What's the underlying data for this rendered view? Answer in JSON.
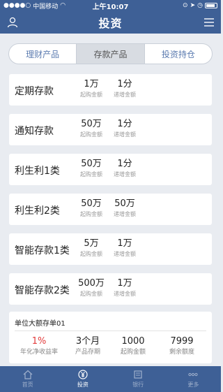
{
  "status": {
    "carrier": "中国移动",
    "time": "上午10:07"
  },
  "nav": {
    "title": "投资"
  },
  "segments": [
    "理财产品",
    "存款产品",
    "投资持仓"
  ],
  "products": [
    {
      "name": "定期存款",
      "min_amount": "1万",
      "min_label": "起购金额",
      "step": "1分",
      "step_label": "递增金额"
    },
    {
      "name": "通知存款",
      "min_amount": "50万",
      "min_label": "起购金额",
      "step": "1分",
      "step_label": "递增金额"
    },
    {
      "name": "利生利1类",
      "min_amount": "50万",
      "min_label": "起购金额",
      "step": "1分",
      "step_label": "递增金额"
    },
    {
      "name": "利生利2类",
      "min_amount": "50万",
      "min_label": "起购金额",
      "step": "50万",
      "step_label": "递增金额"
    },
    {
      "name": "智能存款1类",
      "min_amount": "5万",
      "min_label": "起购金额",
      "step": "1万",
      "step_label": "递增金额"
    },
    {
      "name": "智能存款2类",
      "min_amount": "500万",
      "min_label": "起购金额",
      "step": "1万",
      "step_label": "递增金额"
    }
  ],
  "featured": {
    "title": "单位大额存单01",
    "rate": "1%",
    "rate_label": "年化净收益率",
    "term": "3个月",
    "term_label": "产品存期",
    "min_amount": "1000",
    "min_label": "起购金额",
    "remaining": "7999",
    "remaining_label": "剩余额度"
  },
  "tabs": [
    {
      "label": "首页",
      "icon": "home-icon"
    },
    {
      "label": "投资",
      "icon": "yuan-icon"
    },
    {
      "label": "银行",
      "icon": "bank-icon"
    },
    {
      "label": "更多",
      "icon": "more-icon"
    }
  ],
  "colors": {
    "primary": "#3e6096",
    "accent_red": "#e23b3b",
    "background": "#e9ecf1"
  }
}
